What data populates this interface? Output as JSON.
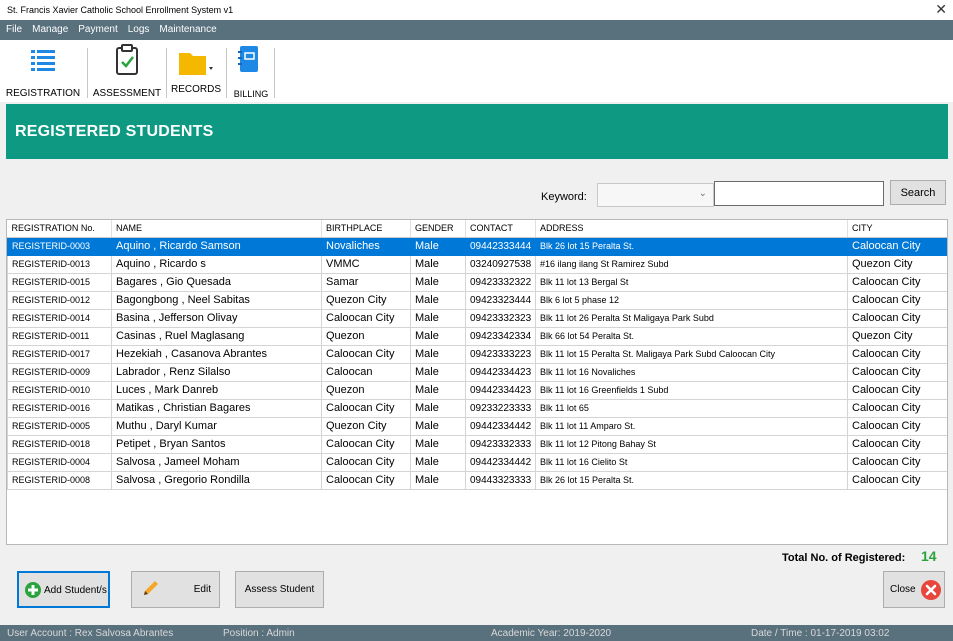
{
  "window": {
    "title": "St. Francis Xavier Catholic School Enrollment System v1"
  },
  "menu": [
    "File",
    "Manage",
    "Payment",
    "Logs",
    "Maintenance"
  ],
  "toolbar": {
    "registration": "REGISTRATION",
    "assessment": "ASSESSMENT",
    "records": "RECORDS",
    "billing": "BILLING"
  },
  "header": {
    "title": "REGISTERED STUDENTS"
  },
  "search": {
    "keyword_label": "Keyword:",
    "keyword_value": "",
    "input_value": "",
    "button": "Search"
  },
  "table": {
    "columns": [
      "REGISTRATION No.",
      "NAME",
      "BIRTHPLACE",
      "GENDER",
      "CONTACT",
      "ADDRESS",
      "CITY"
    ],
    "selected_row": 0,
    "rows": [
      [
        "REGISTERID-0003",
        "Aquino , Ricardo Samson",
        "Novaliches",
        "Male",
        "09442333444",
        "Blk 26 lot 15 Peralta St.",
        "Caloocan City"
      ],
      [
        "REGISTERID-0013",
        "Aquino , Ricardo s",
        "VMMC",
        "Male",
        "03240927538",
        "#16 ilang ilang St Ramirez Subd",
        "Quezon City"
      ],
      [
        "REGISTERID-0015",
        "Bagares , Gio Quesada",
        "Samar",
        "Male",
        "09423332322",
        "Blk 11 lot 13 Bergal St",
        "Caloocan City"
      ],
      [
        "REGISTERID-0012",
        "Bagongbong , Neel Sabitas",
        "Quezon City",
        "Male",
        "09423323444",
        "Blk 6 lot 5 phase 12",
        "Caloocan City"
      ],
      [
        "REGISTERID-0014",
        "Basina , Jefferson Olivay",
        "Caloocan City",
        "Male",
        "09423332323",
        "Blk 11 lot 26 Peralta St Maligaya Park Subd",
        "Caloocan City"
      ],
      [
        "REGISTERID-0011",
        "Casinas , Ruel Maglasang",
        "Quezon",
        "Male",
        "09423342334",
        "Blk 66 lot 54 Peralta St.",
        "Quezon City"
      ],
      [
        "REGISTERID-0017",
        "Hezekiah , Casanova Abrantes",
        "Caloocan City",
        "Male",
        "09423333223",
        "Blk 11 lot 15 Peralta St. Maligaya Park Subd Caloocan City",
        "Caloocan City"
      ],
      [
        "REGISTERID-0009",
        "Labrador , Renz Silalso",
        "Caloocan",
        "Male",
        "09442334423",
        "Blk 11 lot 16 Novaliches",
        "Caloocan City"
      ],
      [
        "REGISTERID-0010",
        "Luces , Mark Danreb",
        "Quezon",
        "Male",
        "09442334423",
        "Blk 11 lot 16 Greenfields 1 Subd",
        "Caloocan City"
      ],
      [
        "REGISTERID-0016",
        "Matikas , Christian Bagares",
        "Caloocan City",
        "Male",
        "09233223333",
        "Blk 11 lot 65",
        "Caloocan City"
      ],
      [
        "REGISTERID-0005",
        "Muthu , Daryl Kumar",
        "Quezon City",
        "Male",
        "09442334442",
        "Blk 11 lot 11 Amparo St.",
        "Caloocan City"
      ],
      [
        "REGISTERID-0018",
        "Petipet , Bryan Santos",
        "Caloocan City",
        "Male",
        "09423332333",
        "Blk 11 lot 12 Pitong Bahay St",
        "Caloocan City"
      ],
      [
        "REGISTERID-0004",
        "Salvosa , Jameel Moham",
        "Caloocan City",
        "Male",
        "09442334442",
        "Blk 11 lot 16 Cielito St",
        "Caloocan City"
      ],
      [
        "REGISTERID-0008",
        "Salvosa , Gregorio Rondilla",
        "Caloocan City",
        "Male",
        "09443323333",
        "Blk 26 lot 15 Peralta St.",
        "Caloocan City"
      ]
    ]
  },
  "summary": {
    "label": "Total No. of Registered:",
    "value": "14"
  },
  "buttons": {
    "add": "Add Student/s",
    "edit": "Edit",
    "assess": "Assess Student",
    "close": "Close"
  },
  "status": {
    "user": "User Account :  Rex Salvosa Abrantes",
    "position": "Position :  Admin",
    "academic_year": "Academic Year:  2019-2020",
    "datetime": "Date / Time :  01-17-2019 03:02"
  },
  "colors": {
    "header_teal": "#0e9a82",
    "bar_slate": "#59707d",
    "selection_blue": "#0078d7",
    "total_green": "#2aa33c",
    "close_red": "#e8453c"
  }
}
